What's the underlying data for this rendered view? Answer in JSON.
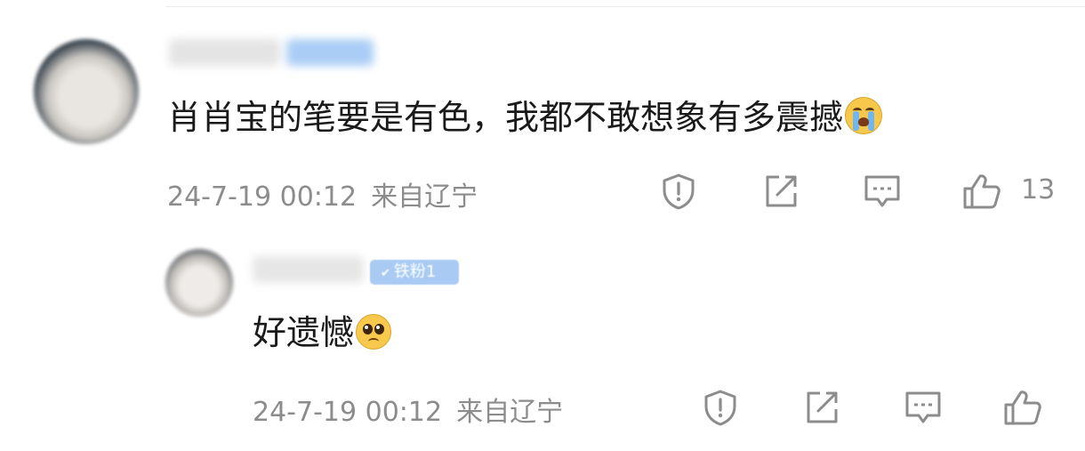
{
  "comments": [
    {
      "text": "肖肖宝的笔要是有色，我都不敢想象有多震撼",
      "emoji": "crying-face",
      "time": "24-7-19 00:12",
      "location": "来自辽宁",
      "likes": "13"
    }
  ],
  "reply": {
    "badge": "铁粉1",
    "text": "好遗憾",
    "emoji": "pleading-face",
    "time": "24-7-19 00:12",
    "location": "来自辽宁"
  },
  "icons": {
    "report": "shield-exclamation-icon",
    "share": "external-share-icon",
    "reply": "comment-bubble-icon",
    "like": "thumbs-up-icon"
  },
  "colors": {
    "text": "#1a1a1a",
    "meta": "#8c8c8c",
    "badge": "#a9cbf3"
  }
}
